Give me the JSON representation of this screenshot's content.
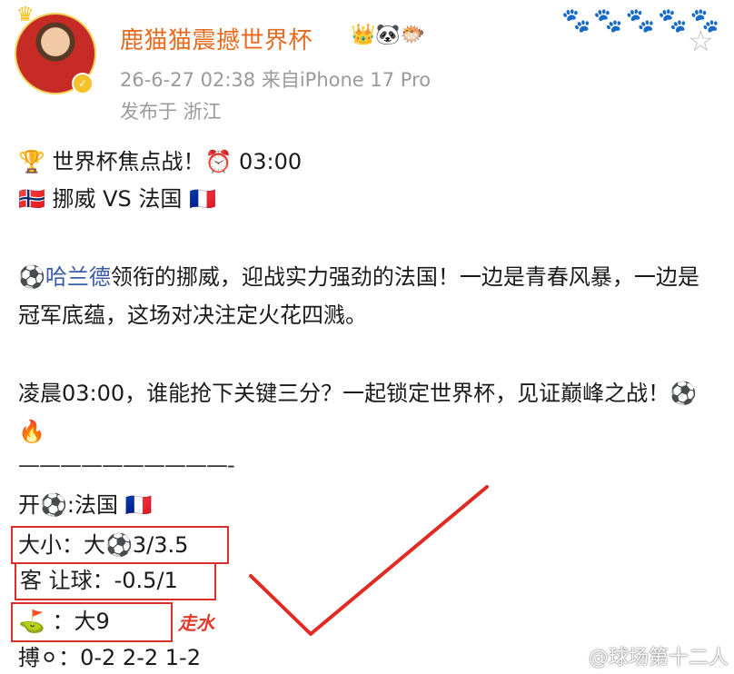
{
  "header": {
    "author": "鹿猫猫震撼世界杯",
    "badges": "👑🐼🐡",
    "meta": "26-6-27 02:38  来自iPhone 17 Pro",
    "location": "发布于 浙江",
    "paws": "🐾🐾🐾🐾🐾"
  },
  "content": {
    "line1": "🏆 世界杯焦点战！⏰ 03:00",
    "line2": "🇳🇴 挪威 VS 法国 🇫🇷",
    "mention": "⚽哈兰德",
    "para1_rest": "领衔的挪威，迎战实力强劲的法国！一边是青春风暴，一边是冠军底蕴，这场对决注定火花四溅。",
    "para2": "凌晨03:00，谁能抢下关键三分？一起锁定世界杯，见证巅峰之战！⚽🔥",
    "divider": "——————————-",
    "open": "开⚽:法国 🇫🇷",
    "over_under": "大小：大⚽3/3.5",
    "handicap": "客  让球：-0.5/1",
    "pick": "⛳    ：大9",
    "push_note": "走水",
    "scores": "搏⚪：0-2    2-2    1-2"
  },
  "watermark": "@球场第十二人",
  "colors": {
    "author": "#e86a1e",
    "mention": "#3b5ca8",
    "highlight": "#d9302b",
    "meta": "#9a9a9a"
  }
}
